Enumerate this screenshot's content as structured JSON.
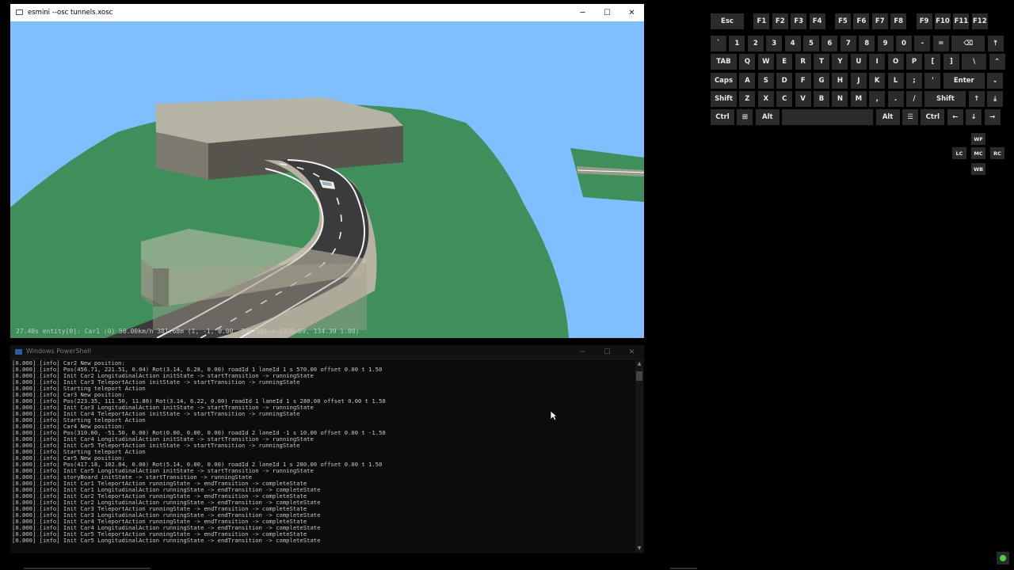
{
  "esmini_window": {
    "title": "esmini --osc tunnels.xosc",
    "hud_text": "27.40s entity[0]: Car1 (0) 50.00km/h 381.68m (1, -1, 0.00, 390.19) / (326.59, 134.39 1.00)"
  },
  "window_controls": {
    "minimize": "─",
    "maximize": "☐",
    "close": "✕"
  },
  "powershell": {
    "title": "Windows PowerShell",
    "lines": [
      "[0.000] [info] Car2 New position:",
      "[0.000] [info] Pos(456.71, 221.51, 0.04) Rot(3.14, 6.28, 0.00) roadId 1 laneId 1 s 570.00 offset 0.00 t 1.50",
      "[0.000] [info] Init Car2 LongitudinalAction initState -> startTransition -> runningState",
      "[0.000] [info] Init Car3 TeleportAction initState -> startTransition -> runningState",
      "[0.000] [info] Starting teleport Action",
      "[0.000] [info] Car3 New position:",
      "[0.000] [info] Pos(223.35, 111.50, 11.86) Rot(3.14, 6.22, 0.00) roadId 1 laneId 1 s 280.00 offset 0.00 t 1.50",
      "[0.000] [info] Init Car3 LongitudinalAction initState -> startTransition -> runningState",
      "[0.000] [info] Init Car4 TeleportAction initState -> startTransition -> runningState",
      "[0.000] [info] Starting teleport Action",
      "[0.000] [info] Car4 New position:",
      "[0.000] [info] Pos(310.00, -51.50, 0.00) Rot(0.00, 0.00, 0.00) roadId 2 laneId -1 s 10.00 offset 0.00 t -1.50",
      "[0.000] [info] Init Car4 LongitudinalAction initState -> startTransition -> runningState",
      "[0.000] [info] Init Car5 TeleportAction initState -> startTransition -> runningState",
      "[0.000] [info] Starting teleport Action",
      "[0.000] [info] Car5 New position:",
      "[0.000] [info] Pos(417.18, 102.84, 0.00) Rot(5.14, 0.00, 0.00) roadId 2 laneId 1 s 280.00 offset 0.00 t 1.50",
      "[0.000] [info] Init Car5 LongitudinalAction initState -> startTransition -> runningState",
      "[0.000] [info] storyBoard initState -> startTransition -> runningState",
      "[0.000] [info] Init Car1 TeleportAction runningState -> endTransition -> completeState",
      "[0.000] [info] Init Car1 LongitudinalAction runningState -> endTransition -> completeState",
      "[0.000] [info] Init Car2 TeleportAction runningState -> endTransition -> completeState",
      "[0.000] [info] Init Car2 LongitudinalAction runningState -> endTransition -> completeState",
      "[0.000] [info] Init Car3 TeleportAction runningState -> endTransition -> completeState",
      "[0.000] [info] Init Car3 LongitudinalAction runningState -> endTransition -> completeState",
      "[0.000] [info] Init Car4 TeleportAction runningState -> endTransition -> completeState",
      "[0.000] [info] Init Car4 LongitudinalAction runningState -> endTransition -> completeState",
      "[0.000] [info] Init Car5 TeleportAction runningState -> endTransition -> completeState",
      "[0.000] [info] Init Car5 LongitudinalAction runningState -> endTransition -> completeState"
    ]
  },
  "keyboard": {
    "rows": [
      [
        {
          "label": "Esc",
          "name": "esc"
        },
        {
          "label": "F1",
          "name": "f1"
        },
        {
          "label": "F2",
          "name": "f2"
        },
        {
          "label": "F3",
          "name": "f3"
        },
        {
          "label": "F4",
          "name": "f4"
        },
        {
          "label": "F5",
          "name": "f5"
        },
        {
          "label": "F6",
          "name": "f6"
        },
        {
          "label": "F7",
          "name": "f7"
        },
        {
          "label": "F8",
          "name": "f8"
        },
        {
          "label": "F9",
          "name": "f9"
        },
        {
          "label": "F10",
          "name": "f10"
        },
        {
          "label": "F11",
          "name": "f11"
        },
        {
          "label": "F12",
          "name": "f12"
        }
      ],
      [
        {
          "label": "`",
          "name": "backtick"
        },
        {
          "label": "1",
          "name": "1"
        },
        {
          "label": "2",
          "name": "2"
        },
        {
          "label": "3",
          "name": "3"
        },
        {
          "label": "4",
          "name": "4"
        },
        {
          "label": "5",
          "name": "5"
        },
        {
          "label": "6",
          "name": "6"
        },
        {
          "label": "7",
          "name": "7"
        },
        {
          "label": "8",
          "name": "8"
        },
        {
          "label": "9",
          "name": "9"
        },
        {
          "label": "0",
          "name": "0"
        },
        {
          "label": "-",
          "name": "minus"
        },
        {
          "label": "=",
          "name": "equals"
        },
        {
          "label": "⌫",
          "name": "backspace"
        },
        {
          "label": "⤒",
          "name": "page-up"
        }
      ],
      [
        {
          "label": "TAB",
          "name": "tab"
        },
        {
          "label": "Q",
          "name": "q"
        },
        {
          "label": "W",
          "name": "w"
        },
        {
          "label": "E",
          "name": "e"
        },
        {
          "label": "R",
          "name": "r"
        },
        {
          "label": "T",
          "name": "t"
        },
        {
          "label": "Y",
          "name": "y"
        },
        {
          "label": "U",
          "name": "u"
        },
        {
          "label": "I",
          "name": "i"
        },
        {
          "label": "O",
          "name": "o"
        },
        {
          "label": "P",
          "name": "p"
        },
        {
          "label": "[",
          "name": "lbracket"
        },
        {
          "label": "]",
          "name": "rbracket"
        },
        {
          "label": "\\",
          "name": "backslash"
        },
        {
          "label": "⌃",
          "name": "up-caret"
        }
      ],
      [
        {
          "label": "Caps",
          "name": "caps"
        },
        {
          "label": "A",
          "name": "a"
        },
        {
          "label": "S",
          "name": "s"
        },
        {
          "label": "D",
          "name": "d"
        },
        {
          "label": "F",
          "name": "f"
        },
        {
          "label": "G",
          "name": "g"
        },
        {
          "label": "H",
          "name": "h"
        },
        {
          "label": "J",
          "name": "j"
        },
        {
          "label": "K",
          "name": "k"
        },
        {
          "label": "L",
          "name": "l"
        },
        {
          "label": ";",
          "name": "semicolon"
        },
        {
          "label": "'",
          "name": "quote"
        },
        {
          "label": "Enter",
          "name": "enter"
        },
        {
          "label": "⌄",
          "name": "down-caret"
        }
      ],
      [
        {
          "label": "Shift",
          "name": "shift-left"
        },
        {
          "label": "Z",
          "name": "z"
        },
        {
          "label": "X",
          "name": "x"
        },
        {
          "label": "C",
          "name": "c"
        },
        {
          "label": "V",
          "name": "v"
        },
        {
          "label": "B",
          "name": "b"
        },
        {
          "label": "N",
          "name": "n"
        },
        {
          "label": "M",
          "name": "m"
        },
        {
          "label": ",",
          "name": "comma"
        },
        {
          "label": ".",
          "name": "period"
        },
        {
          "label": "/",
          "name": "slash"
        },
        {
          "label": "Shift",
          "name": "shift-right"
        },
        {
          "label": "↑",
          "name": "arrow-up"
        },
        {
          "label": "⤓",
          "name": "page-down"
        }
      ],
      [
        {
          "label": "Ctrl",
          "name": "ctrl-left"
        },
        {
          "label": "⊞",
          "name": "windows"
        },
        {
          "label": "Alt",
          "name": "alt-left"
        },
        {
          "label": "",
          "name": "space"
        },
        {
          "label": "Alt",
          "name": "alt-right"
        },
        {
          "label": "☰",
          "name": "menu"
        },
        {
          "label": "Ctrl",
          "name": "ctrl-right"
        },
        {
          "label": "←",
          "name": "arrow-left"
        },
        {
          "label": "↓",
          "name": "arrow-down"
        },
        {
          "label": "→",
          "name": "arrow-right"
        }
      ]
    ],
    "mouse_pad": [
      {
        "label": "WF",
        "name": "wheel-forward"
      },
      {
        "label": "LC",
        "name": "left-click"
      },
      {
        "label": "MC",
        "name": "middle-click"
      },
      {
        "label": "RC",
        "name": "right-click"
      },
      {
        "label": "WB",
        "name": "wheel-back"
      }
    ]
  }
}
